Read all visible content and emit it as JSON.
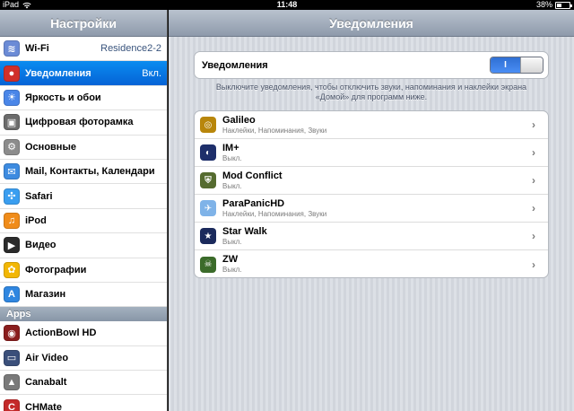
{
  "status_bar": {
    "device": "iPad",
    "time": "11:48",
    "battery": "38%",
    "battery_level": 0.38
  },
  "sidebar": {
    "title": "Настройки",
    "items": [
      {
        "label": "Wi-Fi",
        "value": "Residence2-2",
        "icon": "wifi-icon",
        "color": "#6b8bd6",
        "glyph": "≋"
      },
      {
        "label": "Уведомления",
        "value": "Вкл.",
        "icon": "notifications-icon",
        "color": "#d0302b",
        "glyph": "●",
        "selected": true
      },
      {
        "label": "Яркость и обои",
        "value": "",
        "icon": "brightness-icon",
        "color": "#4a86e8",
        "glyph": "☀"
      },
      {
        "label": "Цифровая фоторамка",
        "value": "",
        "icon": "picture-frame-icon",
        "color": "#6c6c6c",
        "glyph": "▣"
      },
      {
        "label": "Основные",
        "value": "",
        "icon": "gear-icon",
        "color": "#8c8c8c",
        "glyph": "⚙"
      },
      {
        "label": "Mail, Контакты, Календари",
        "value": "",
        "icon": "mail-icon",
        "color": "#3d8be0",
        "glyph": "✉"
      },
      {
        "label": "Safari",
        "value": "",
        "icon": "safari-icon",
        "color": "#3a9ef0",
        "glyph": "✣"
      },
      {
        "label": "iPod",
        "value": "",
        "icon": "ipod-icon",
        "color": "#f08c1a",
        "glyph": "♫"
      },
      {
        "label": "Видео",
        "value": "",
        "icon": "video-icon",
        "color": "#2b2b2b",
        "glyph": "▶"
      },
      {
        "label": "Фотографии",
        "value": "",
        "icon": "photos-icon",
        "color": "#f2b705",
        "glyph": "✿"
      },
      {
        "label": "Магазин",
        "value": "",
        "icon": "store-icon",
        "color": "#2f86e0",
        "glyph": "A"
      }
    ],
    "section_label": "Apps",
    "apps": [
      {
        "label": "ActionBowl HD",
        "icon": "actionbowl-icon",
        "color": "#8a1e1e",
        "glyph": "◉"
      },
      {
        "label": "Air Video",
        "icon": "air-video-icon",
        "color": "#3a4f7a",
        "glyph": "▭"
      },
      {
        "label": "Canabalt",
        "icon": "canabalt-icon",
        "color": "#7a7a7a",
        "glyph": "▲"
      },
      {
        "label": "CHMate",
        "icon": "chmate-icon",
        "color": "#c42a2a",
        "glyph": "C"
      }
    ]
  },
  "main": {
    "title": "Уведомления",
    "toggle": {
      "label": "Уведомления",
      "state_label": "I",
      "on": true
    },
    "description": "Выключите уведомления, чтобы отключить звуки, напоминания и наклейки экрана «Домой» для программ ниже.",
    "apps": [
      {
        "name": "Galileo",
        "sub": "Наклейки, Напоминания, Звуки",
        "icon": "galileo-icon",
        "color": "#b8860b",
        "glyph": "◎"
      },
      {
        "name": "IM+",
        "sub": "Выкл.",
        "icon": "im-plus-icon",
        "color": "#1e2f6b",
        "glyph": "◐"
      },
      {
        "name": "Mod Conflict",
        "sub": "Выкл.",
        "icon": "mod-conflict-icon",
        "color": "#556b2f",
        "glyph": "⛨"
      },
      {
        "name": "ParaPanicHD",
        "sub": "Наклейки, Напоминания, Звуки",
        "icon": "parapanic-icon",
        "color": "#7fb3e8",
        "glyph": "✈"
      },
      {
        "name": "Star Walk",
        "sub": "Выкл.",
        "icon": "star-walk-icon",
        "color": "#1b2a5c",
        "glyph": "★"
      },
      {
        "name": "ZW",
        "sub": "Выкл.",
        "icon": "zw-icon",
        "color": "#3b6b2a",
        "glyph": "☠"
      }
    ],
    "chevron": "›"
  }
}
